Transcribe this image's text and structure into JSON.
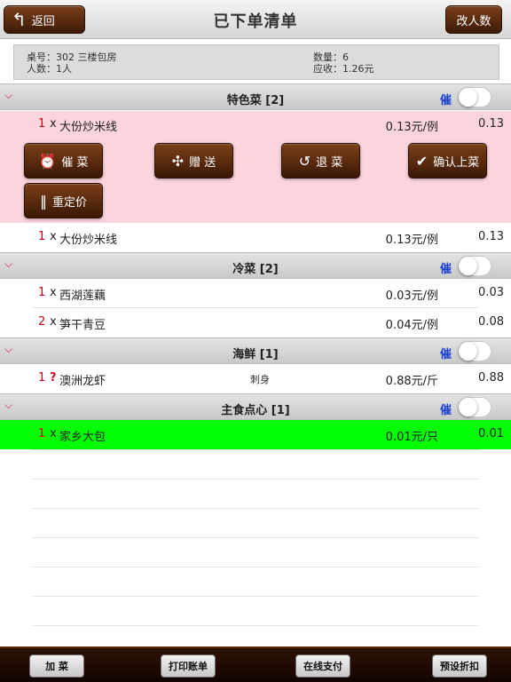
{
  "header": {
    "title": "已下单清单",
    "back_label": "返回",
    "change_people_label": "改人数"
  },
  "order_info": {
    "table": "桌号：302 三楼包房",
    "people": "人数：1人",
    "quantity": "数量：6",
    "receivable": "应收：1.26元"
  },
  "urge_label": "催",
  "sections": [
    {
      "name": "特色菜 [2]",
      "urge_on": false,
      "items": [
        {
          "qty": "1",
          "mark": "x",
          "name": "大份炒米线",
          "note": "",
          "price": "0.13元/例",
          "total": "0.13"
        },
        {
          "qty": "1",
          "mark": "x",
          "name": "大份炒米线",
          "note": "",
          "price": "0.13元/例",
          "total": "0.13"
        }
      ]
    },
    {
      "name": "冷菜 [2]",
      "urge_on": false,
      "items": [
        {
          "qty": "1",
          "mark": "x",
          "name": "西湖莲藕",
          "note": "",
          "price": "0.03元/例",
          "total": "0.03"
        },
        {
          "qty": "2",
          "mark": "x",
          "name": "笋干青豆",
          "note": "",
          "price": "0.04元/例",
          "total": "0.08"
        }
      ]
    },
    {
      "name": "海鲜 [1]",
      "urge_on": false,
      "items": [
        {
          "qty": "1",
          "mark": "?",
          "name": "澳洲龙虾",
          "note": "刺身",
          "price": "0.88元/斤",
          "total": "0.88"
        }
      ]
    },
    {
      "name": "主食点心 [1]",
      "urge_on": false,
      "items": [
        {
          "qty": "1",
          "mark": "x",
          "name": "家乡大包",
          "note": "",
          "price": "0.01元/只",
          "total": "0.01"
        }
      ]
    }
  ],
  "actions": {
    "urge": "催 菜",
    "gift": "赠 送",
    "return": "退 菜",
    "confirm": "确认上菜",
    "reprice": "重定价"
  },
  "colors": {
    "selected_row": "#fbd4dc",
    "served_row": "#00ff00",
    "urge_text": "#1a3fd1",
    "qty_text": "#d0021b"
  },
  "icons": {
    "back": "back-arrow-icon",
    "urge": "alarm-clock-icon",
    "gift": "gift-icon",
    "return": "undo-arrow-icon",
    "confirm": "checkmark-icon",
    "reprice": "fork-knife-icon",
    "collapse": "chevron-down-icon"
  },
  "bottom": {
    "add": "加 菜",
    "print": "打印账单",
    "online_pay": "在线支付",
    "discount": "预设折扣"
  }
}
